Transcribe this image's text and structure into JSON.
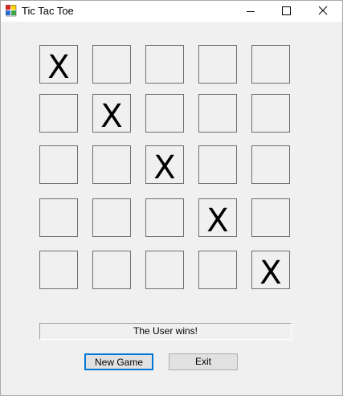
{
  "window": {
    "title": "Tic Tac Toe"
  },
  "titlebar_buttons": {
    "minimize_icon": "minimize-icon",
    "maximize_icon": "maximize-icon",
    "close_icon": "close-icon"
  },
  "board": {
    "rows": [
      [
        "X",
        "",
        "",
        "",
        ""
      ],
      [
        "",
        "X",
        "",
        "",
        ""
      ],
      [
        "",
        "",
        "X",
        "",
        ""
      ],
      [
        "",
        "",
        "",
        "X",
        ""
      ],
      [
        "",
        "",
        "",
        "",
        "X"
      ]
    ]
  },
  "status": {
    "text": "The User wins!"
  },
  "buttons": {
    "new_game": "New Game",
    "exit": "Exit"
  },
  "colors": {
    "focus_accent": "#0078d7"
  }
}
